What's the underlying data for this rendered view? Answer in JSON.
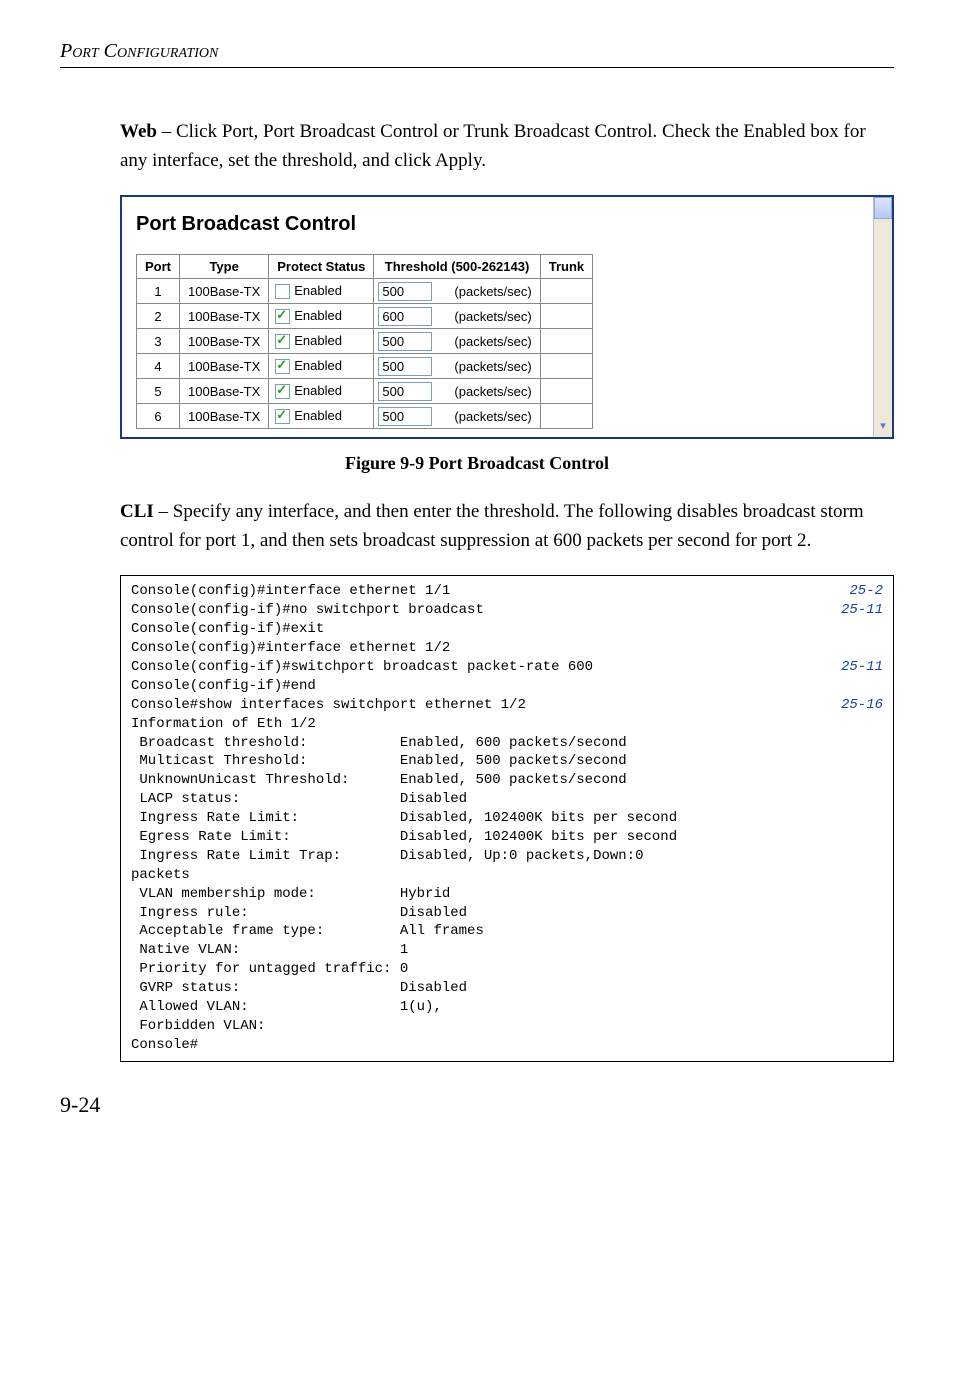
{
  "section_header": "Port Configuration",
  "web_intro_html": "Web – Click Port, Port Broadcast Control or Trunk Broadcast Control. Check the Enabled box for any interface, set the threshold, and click Apply.",
  "panel_title": "Port Broadcast Control",
  "table": {
    "headers": {
      "port": "Port",
      "type": "Type",
      "protect": "Protect Status",
      "threshold": "Threshold (500-262143)",
      "trunk": "Trunk"
    },
    "unit": "(packets/sec)",
    "rows": [
      {
        "port": "1",
        "type": "100Base-TX",
        "enabled": false,
        "threshold": "500",
        "trunk": ""
      },
      {
        "port": "2",
        "type": "100Base-TX",
        "enabled": true,
        "threshold": "600",
        "trunk": ""
      },
      {
        "port": "3",
        "type": "100Base-TX",
        "enabled": true,
        "threshold": "500",
        "trunk": ""
      },
      {
        "port": "4",
        "type": "100Base-TX",
        "enabled": true,
        "threshold": "500",
        "trunk": ""
      },
      {
        "port": "5",
        "type": "100Base-TX",
        "enabled": true,
        "threshold": "500",
        "trunk": ""
      },
      {
        "port": "6",
        "type": "100Base-TX",
        "enabled": true,
        "threshold": "500",
        "trunk": ""
      }
    ],
    "enabled_label": "Enabled"
  },
  "figure_caption": "Figure 9-9  Port Broadcast Control",
  "cli_intro_html": "CLI – Specify any interface, and then enter the threshold. The following disables broadcast storm control for port 1, and then sets broadcast suppression at 600 packets per second for port 2.",
  "cli": {
    "lines": [
      {
        "text": "Console(config)#interface ethernet 1/1",
        "ref": "25-2"
      },
      {
        "text": "Console(config-if)#no switchport broadcast",
        "ref": "25-11"
      },
      {
        "text": "Console(config-if)#exit",
        "ref": ""
      },
      {
        "text": "Console(config)#interface ethernet 1/2",
        "ref": ""
      },
      {
        "text": "Console(config-if)#switchport broadcast packet-rate 600",
        "ref": "25-11"
      },
      {
        "text": "Console(config-if)#end",
        "ref": ""
      },
      {
        "text": "Console#show interfaces switchport ethernet 1/2",
        "ref": "25-16"
      },
      {
        "text": "Information of Eth 1/2",
        "ref": ""
      },
      {
        "text": " Broadcast threshold:           Enabled, 600 packets/second",
        "ref": ""
      },
      {
        "text": " Multicast Threshold:           Enabled, 500 packets/second",
        "ref": ""
      },
      {
        "text": " UnknownUnicast Threshold:      Enabled, 500 packets/second",
        "ref": ""
      },
      {
        "text": " LACP status:                   Disabled",
        "ref": ""
      },
      {
        "text": " Ingress Rate Limit:            Disabled, 102400K bits per second",
        "ref": ""
      },
      {
        "text": " Egress Rate Limit:             Disabled, 102400K bits per second",
        "ref": ""
      },
      {
        "text": " Ingress Rate Limit Trap:       Disabled, Up:0 packets,Down:0 ",
        "ref": ""
      },
      {
        "text": "packets",
        "ref": ""
      },
      {
        "text": " VLAN membership mode:          Hybrid",
        "ref": ""
      },
      {
        "text": " Ingress rule:                  Disabled",
        "ref": ""
      },
      {
        "text": " Acceptable frame type:         All frames",
        "ref": ""
      },
      {
        "text": " Native VLAN:                   1",
        "ref": ""
      },
      {
        "text": " Priority for untagged traffic: 0",
        "ref": ""
      },
      {
        "text": " GVRP status:                   Disabled",
        "ref": ""
      },
      {
        "text": " Allowed VLAN:                  1(u),",
        "ref": ""
      },
      {
        "text": " Forbidden VLAN:                ",
        "ref": ""
      },
      {
        "text": "Console#",
        "ref": ""
      }
    ]
  },
  "page_number": "9-24"
}
